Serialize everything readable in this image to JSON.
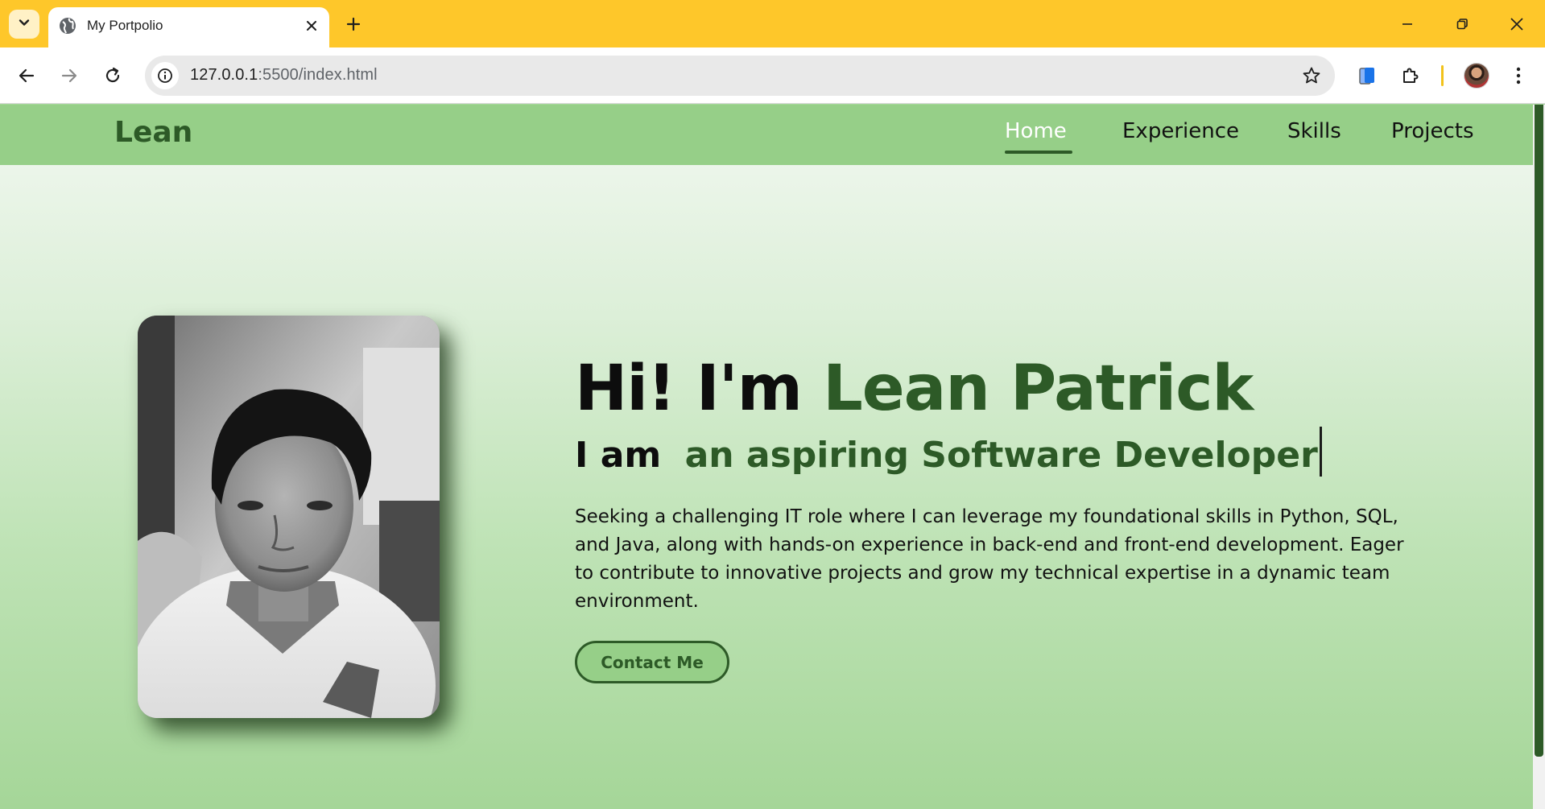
{
  "browser": {
    "tab_title": "My Portpolio",
    "url_host": "127.0.0.1",
    "url_path": ":5500/index.html"
  },
  "icons": {
    "tab_search": "chevron-down-icon",
    "tab_favicon": "globe-icon",
    "tab_close": "close-icon",
    "new_tab": "plus-icon",
    "minimize": "minimize-icon",
    "restore": "restore-icon",
    "close_window": "close-icon",
    "back": "arrow-left-icon",
    "forward": "arrow-right-icon",
    "reload": "reload-icon",
    "site_info": "info-icon",
    "bookmark": "star-icon",
    "extension_phone": "phone-icon",
    "extensions": "puzzle-icon",
    "menu": "kebab-menu-icon"
  },
  "site": {
    "logo": "Lean",
    "nav": [
      {
        "label": "Home",
        "active": true
      },
      {
        "label": "Experience",
        "active": false
      },
      {
        "label": "Skills",
        "active": false
      },
      {
        "label": "Projects",
        "active": false
      }
    ]
  },
  "hero": {
    "greeting": "Hi! I'm",
    "name": "Lean Patrick",
    "subtitle_prefix": "I am",
    "subtitle_role": "an aspiring Software Developer",
    "description": "Seeking a challenging IT role where I can leverage my foundational skills in Python, SQL, and Java, along with hands-on experience in back-end and front-end development. Eager to contribute to innovative projects and grow my technical expertise in a dynamic team environment.",
    "contact_button": "Contact Me"
  },
  "colors": {
    "chrome_tabbar": "#fec72a",
    "nav_background": "#96cf88",
    "accent_green": "#2d5a27",
    "active_nav_text": "#ffffff"
  }
}
